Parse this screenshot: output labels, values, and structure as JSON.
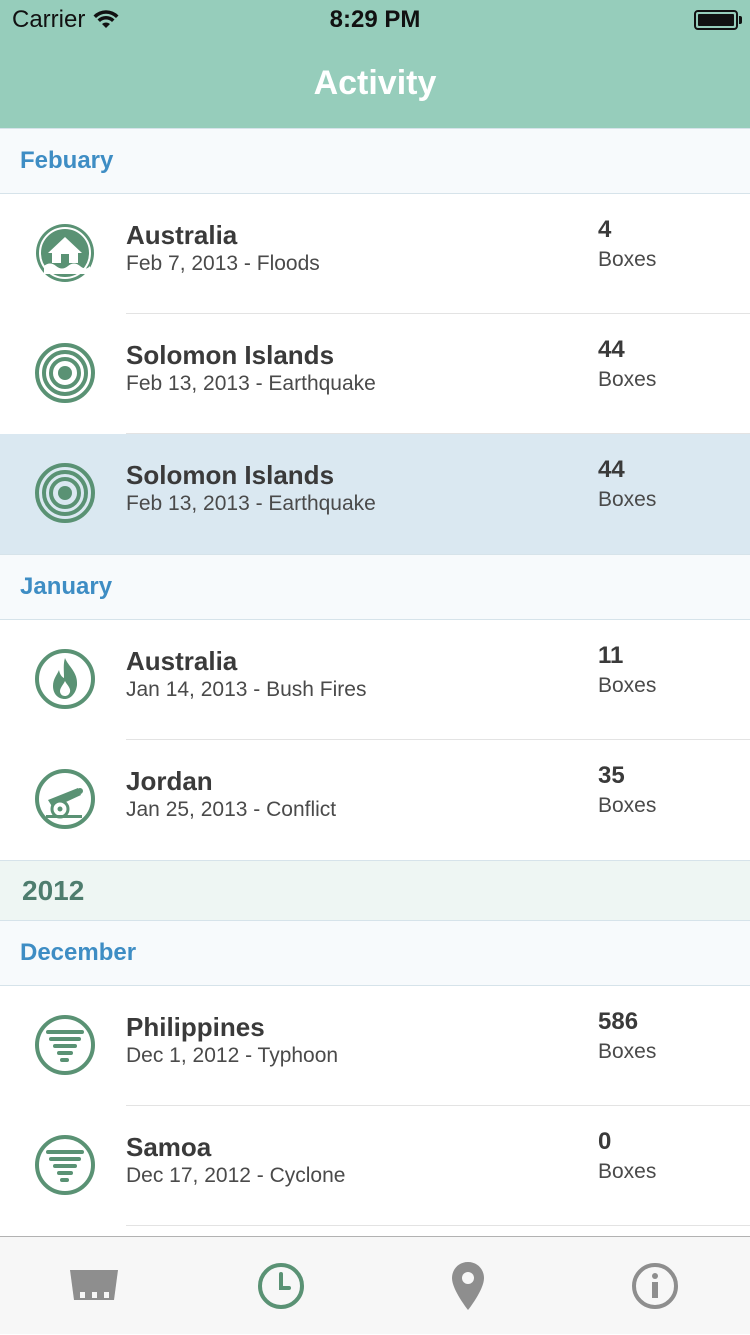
{
  "status_bar": {
    "carrier": "Carrier",
    "time": "8:29 PM"
  },
  "nav": {
    "title": "Activity"
  },
  "sections": {
    "february": {
      "title": "Febuary"
    },
    "january": {
      "title": "January"
    },
    "year_2012": {
      "title": "2012"
    },
    "december": {
      "title": "December"
    }
  },
  "rows": [
    {
      "place": "Australia",
      "detail": "Feb 7, 2013 - Floods",
      "count": "4",
      "unit": "Boxes",
      "icon": "flood-house-icon"
    },
    {
      "place": "Solomon Islands",
      "detail": "Feb 13, 2013 - Earthquake",
      "count": "44",
      "unit": "Boxes",
      "icon": "earthquake-rings-icon"
    },
    {
      "place": "Solomon Islands",
      "detail": "Feb 13, 2013 - Earthquake",
      "count": "44",
      "unit": "Boxes",
      "icon": "earthquake-rings-icon",
      "selected": true
    },
    {
      "place": "Australia",
      "detail": "Jan 14, 2013 - Bush Fires",
      "count": "11",
      "unit": "Boxes",
      "icon": "fire-icon"
    },
    {
      "place": "Jordan",
      "detail": "Jan 25, 2013 - Conflict",
      "count": "35",
      "unit": "Boxes",
      "icon": "cannon-icon"
    },
    {
      "place": "Philippines",
      "detail": "Dec 1, 2012 - Typhoon",
      "count": "586",
      "unit": "Boxes",
      "icon": "tornado-icon"
    },
    {
      "place": "Samoa",
      "detail": "Dec 17, 2012 - Cyclone",
      "count": "0",
      "unit": "Boxes",
      "icon": "tornado-icon"
    }
  ],
  "tabbar": {
    "tabs": [
      {
        "icon": "box-icon",
        "active": false
      },
      {
        "icon": "clock-icon",
        "active": true
      },
      {
        "icon": "map-pin-icon",
        "active": false
      },
      {
        "icon": "info-icon",
        "active": false
      }
    ]
  },
  "colors": {
    "header_bg": "#96cdbb",
    "section_text": "#3e8dc4",
    "year_text": "#4e7d6e",
    "icon_green": "#5a9274",
    "selected_row": "#dae8f1",
    "tab_active": "#5a9274",
    "tab_inactive": "#8e8e8e"
  }
}
